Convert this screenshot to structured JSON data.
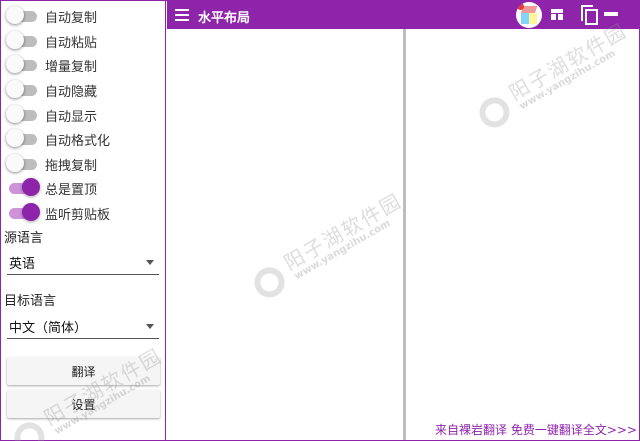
{
  "sidebar": {
    "toggles": [
      {
        "label": "自动复制",
        "on": false
      },
      {
        "label": "自动粘贴",
        "on": false
      },
      {
        "label": "增量复制",
        "on": false
      },
      {
        "label": "自动隐藏",
        "on": false
      },
      {
        "label": "自动显示",
        "on": false
      },
      {
        "label": "自动格式化",
        "on": false
      },
      {
        "label": "拖拽复制",
        "on": false
      },
      {
        "label": "总是置顶",
        "on": true
      },
      {
        "label": "监听剪贴板",
        "on": true
      }
    ],
    "source_lang_label": "源语言",
    "source_lang_value": "英语",
    "target_lang_label": "目标语言",
    "target_lang_value": "中文（简体）",
    "translate_button": "翻译",
    "settings_button": "设置"
  },
  "header": {
    "title": "水平布局"
  },
  "footer": {
    "link_text": "来自裸岩翻译 免费一键翻译全文>>>"
  },
  "watermark": {
    "name": "阳子湖软件园",
    "url": "www.yangzihu.com"
  },
  "colors": {
    "accent": "#8e24aa",
    "accent_light": "#ce93d8",
    "switch_off_track": "#bdbdbd",
    "divider": "#bdbdbd"
  },
  "icons": {
    "menu": "hamburger-icon",
    "app": "app-logo-icon",
    "layout": "layout-icon",
    "copy": "copy-icon",
    "minimize": "minimize-icon",
    "dropdown": "chevron-down-icon"
  }
}
